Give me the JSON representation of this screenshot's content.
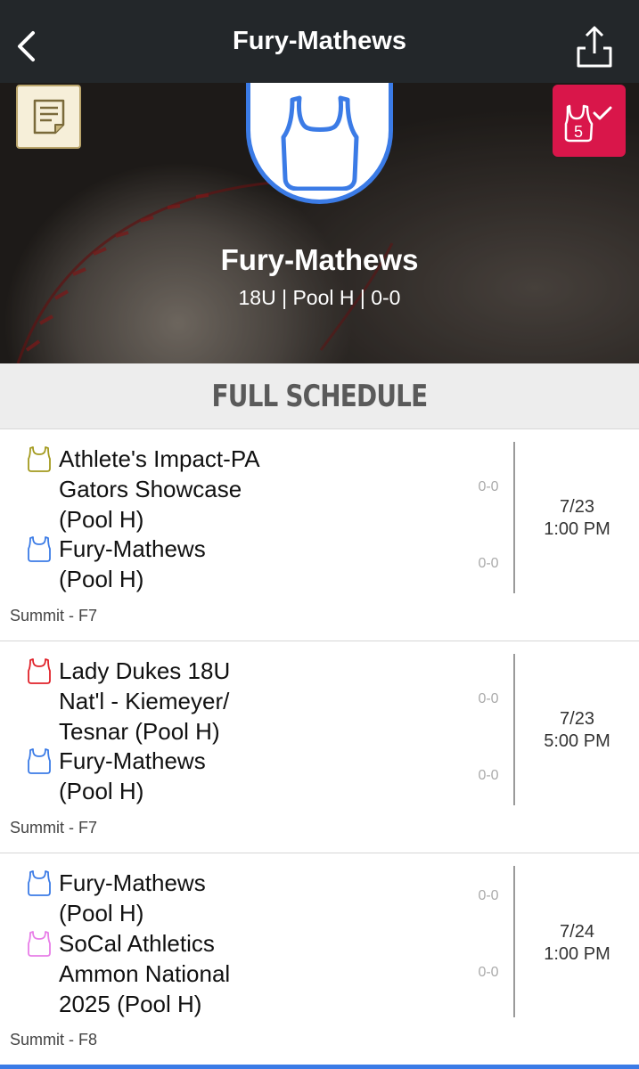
{
  "nav": {
    "title": "Fury-Mathews",
    "back_icon": "chevron-left-icon",
    "share_icon": "share-icon"
  },
  "hero": {
    "team_name": "Fury-Mathews",
    "subtitle": "18U | Pool H | 0-0",
    "notes_icon": "notes-icon",
    "bracket_icon": "bracket-icon",
    "bracket_badge": "5",
    "logo_color": "#3b7be6",
    "bracket_color": "#d9164a"
  },
  "section": {
    "title": "FULL SCHEDULE"
  },
  "games": [
    {
      "home": {
        "name": "Athlete's Impact-PA Gators Showcase (Pool H)",
        "lines": [
          "Athlete's Impact-PA",
          "Gators Showcase",
          "(Pool H)"
        ],
        "jersey_color": "#a39a1e",
        "score": "0-0"
      },
      "away": {
        "name": "Fury-Mathews (Pool H)",
        "lines": [
          "Fury-Mathews",
          "(Pool H)"
        ],
        "jersey_color": "#3b7be6",
        "score": "0-0"
      },
      "date": "7/23",
      "time": "1:00 PM",
      "venue": "Summit - F7"
    },
    {
      "home": {
        "name": "Lady Dukes 18U Nat'l - Kiemeyer/ Tesnar (Pool H)",
        "lines": [
          "Lady Dukes 18U",
          "Nat'l - Kiemeyer/",
          "Tesnar (Pool H)"
        ],
        "jersey_color": "#e0222a",
        "score": "0-0"
      },
      "away": {
        "name": "Fury-Mathews (Pool H)",
        "lines": [
          "Fury-Mathews",
          "(Pool H)"
        ],
        "jersey_color": "#3b7be6",
        "score": "0-0"
      },
      "date": "7/23",
      "time": "5:00 PM",
      "venue": "Summit - F7"
    },
    {
      "home": {
        "name": "Fury-Mathews (Pool H)",
        "lines": [
          "Fury-Mathews",
          "(Pool H)"
        ],
        "jersey_color": "#3b7be6",
        "score": "0-0"
      },
      "away": {
        "name": "SoCal Athletics Ammon National 2025 (Pool H)",
        "lines": [
          "SoCal Athletics",
          "Ammon National",
          "2025 (Pool H)"
        ],
        "jersey_color": "#e87ee8",
        "score": "0-0"
      },
      "date": "7/24",
      "time": "1:00 PM",
      "venue": "Summit - F8"
    }
  ]
}
